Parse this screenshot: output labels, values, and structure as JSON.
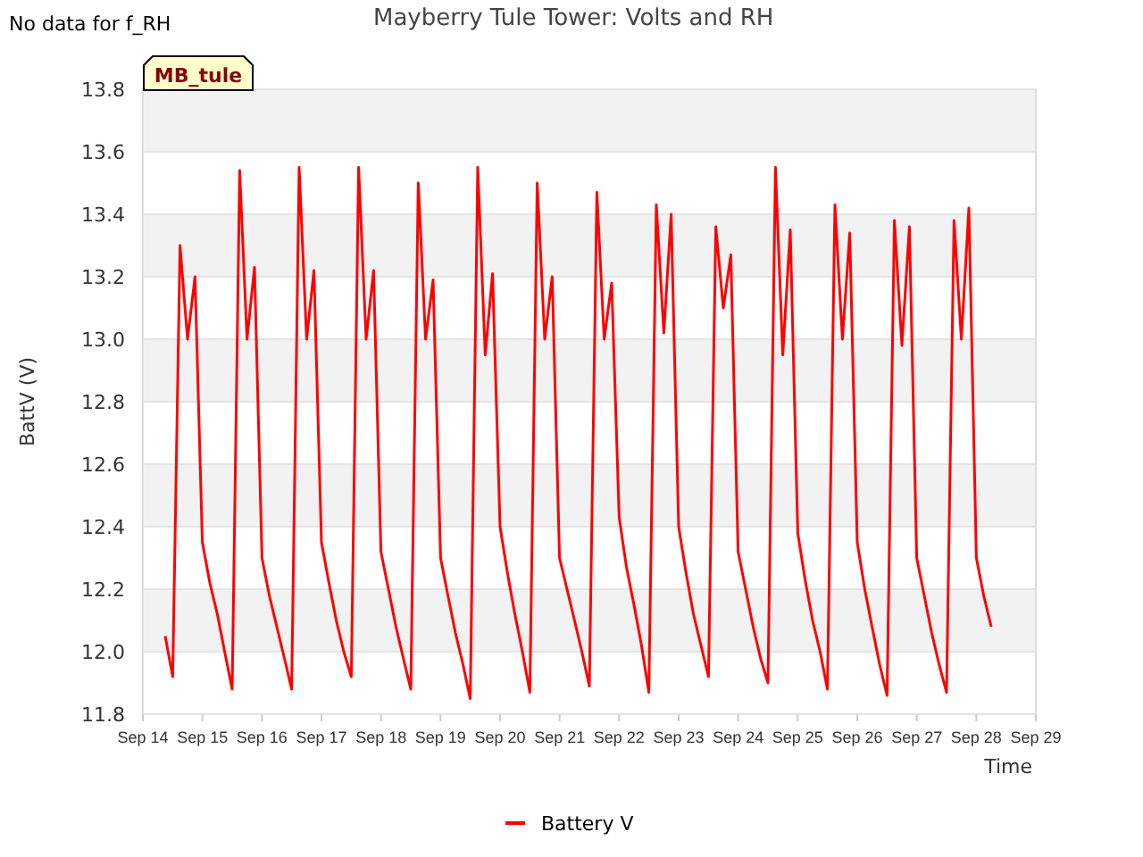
{
  "note": "No data for f_RH",
  "chart": {
    "tag": "MB_tule",
    "chart_data": {
      "type": "line",
      "title": "Mayberry Tule Tower: Volts and RH",
      "xlabel": "Time",
      "ylabel": "BattV (V)",
      "ylim": [
        11.8,
        13.8
      ],
      "grid": true,
      "yticks": [
        {
          "value": 11.8,
          "label": "11.8"
        },
        {
          "value": 12,
          "label": "12.0"
        },
        {
          "value": 12.2,
          "label": "12.2"
        },
        {
          "value": 12.4,
          "label": "12.4"
        },
        {
          "value": 12.6,
          "label": "12.6"
        },
        {
          "value": 12.8,
          "label": "12.8"
        },
        {
          "value": 13,
          "label": "13.0"
        },
        {
          "value": 13.2,
          "label": "13.2"
        },
        {
          "value": 13.4,
          "label": "13.4"
        },
        {
          "value": 13.6,
          "label": "13.6"
        },
        {
          "value": 13.8,
          "label": "13.8"
        }
      ],
      "categories": [
        "Sep 14",
        null,
        null,
        null,
        null,
        null,
        null,
        null,
        "Sep 15",
        null,
        null,
        null,
        null,
        null,
        null,
        null,
        "Sep 16",
        null,
        null,
        null,
        null,
        null,
        null,
        null,
        "Sep 17",
        null,
        null,
        null,
        null,
        null,
        null,
        null,
        "Sep 18",
        null,
        null,
        null,
        null,
        null,
        null,
        null,
        "Sep 19",
        null,
        null,
        null,
        null,
        null,
        null,
        null,
        "Sep 20",
        null,
        null,
        null,
        null,
        null,
        null,
        null,
        "Sep 21",
        null,
        null,
        null,
        null,
        null,
        null,
        null,
        "Sep 22",
        null,
        null,
        null,
        null,
        null,
        null,
        null,
        "Sep 23",
        null,
        null,
        null,
        null,
        null,
        null,
        null,
        "Sep 24",
        null,
        null,
        null,
        null,
        null,
        null,
        null,
        "Sep 25",
        null,
        null,
        null,
        null,
        null,
        null,
        null,
        "Sep 26",
        null,
        null,
        null,
        null,
        null,
        null,
        null,
        "Sep 27",
        null,
        null,
        null,
        null,
        null,
        null,
        null,
        "Sep 28",
        null,
        null,
        null,
        null,
        null,
        null,
        null,
        "Sep 29"
      ],
      "series": [
        {
          "name": "Battery V",
          "color": "#ff0000",
          "values": [
            null,
            null,
            null,
            12.05,
            11.92,
            13.3,
            13.0,
            13.2,
            12.35,
            12.22,
            12.12,
            12.0,
            11.88,
            13.54,
            13.0,
            13.23,
            12.3,
            12.18,
            12.08,
            11.98,
            11.88,
            13.55,
            13.0,
            13.22,
            12.35,
            12.22,
            12.1,
            12.0,
            11.92,
            13.55,
            13.0,
            13.22,
            12.32,
            12.2,
            12.08,
            11.98,
            11.88,
            13.5,
            13.0,
            13.19,
            12.3,
            12.18,
            12.06,
            11.96,
            11.85,
            13.55,
            12.95,
            13.21,
            12.4,
            12.25,
            12.12,
            12.0,
            11.87,
            13.5,
            13.0,
            13.2,
            12.3,
            12.2,
            12.1,
            12.0,
            11.89,
            13.47,
            13.0,
            13.18,
            12.43,
            12.27,
            12.15,
            12.02,
            11.87,
            13.43,
            13.02,
            13.4,
            12.4,
            12.25,
            12.12,
            12.02,
            11.92,
            13.36,
            13.1,
            13.27,
            12.32,
            12.2,
            12.08,
            11.98,
            11.9,
            13.55,
            12.95,
            13.35,
            12.38,
            12.23,
            12.1,
            12.0,
            11.88,
            13.43,
            13.0,
            13.34,
            12.35,
            12.2,
            12.08,
            11.96,
            11.86,
            13.38,
            12.98,
            13.36,
            12.3,
            12.18,
            12.06,
            11.96,
            11.87,
            13.38,
            13.0,
            13.42,
            12.3,
            12.18,
            12.08,
            null,
            null,
            null,
            null,
            null,
            null
          ]
        }
      ]
    }
  }
}
